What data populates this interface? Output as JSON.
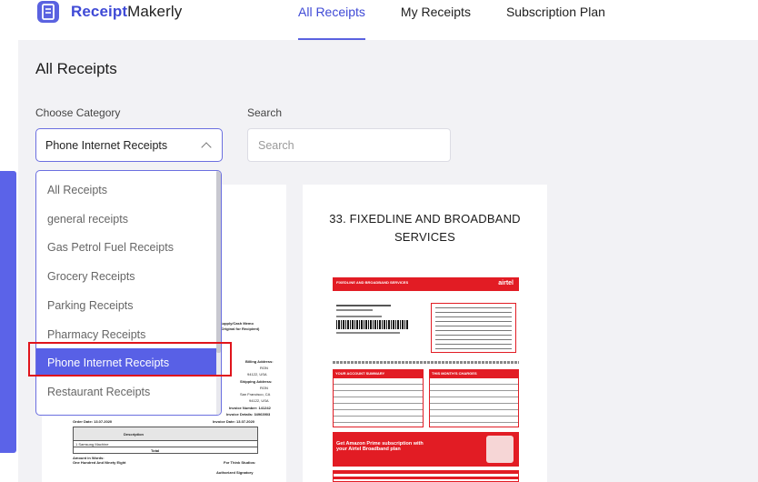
{
  "brand": {
    "name_bold": "Receipt",
    "name_light": "Makerly",
    "icon": "receipt-icon",
    "accent": "#3f4ad6"
  },
  "nav": [
    {
      "label": "All Receipts",
      "active": true
    },
    {
      "label": "My Receipts",
      "active": false
    },
    {
      "label": "Subscription Plan",
      "active": false
    }
  ],
  "page": {
    "title": "All Receipts"
  },
  "filters": {
    "category_label": "Choose Category",
    "category_value": "Phone Internet Receipts",
    "search_label": "Search",
    "search_placeholder": "Search",
    "search_value": ""
  },
  "dropdown": {
    "options": [
      "All Receipts",
      "general receipts",
      "Gas Petrol Fuel Receipts",
      "Grocery Receipts",
      "Parking Receipts",
      "Pharmacy Receipts",
      "Phone Internet Receipts",
      "Restaurant Receipts"
    ],
    "selected": "Phone Internet Receipts",
    "selected_color": "#5860e6"
  },
  "cards": {
    "left": {
      "preview": {
        "bill_header": "Supply/Cash Memo",
        "bill_sub": "(Original for Recipient)",
        "billing_address": "Billing Address:",
        "addr1": "RON",
        "addr2": "94122, USA",
        "shipping_address": "Shipping Address:",
        "addr3": "RON",
        "addr4": "San Francisco, CA",
        "addr5": "94122, USA",
        "invoice_number": "Invoice Number: 141242",
        "invoice_details": "Invoice Details: 34963903",
        "invoice_date": "Invoice Date: 13.07.2020",
        "order_date": "Order Date: 13.07.2020",
        "col_description": "Description",
        "item_name": "1 Samsung Machine",
        "total_label": "Total",
        "amount_words_label": "Amount in Words:",
        "amount_words": "One Hundred And Ninety Eight",
        "for_label": "For Think Studios:",
        "signatory": "Authorized Signatory"
      }
    },
    "right": {
      "title": "33. FIXEDLINE AND BROADBAND SERVICES",
      "preview": {
        "header": "FIXEDLINE AND BROADBAND SERVICES",
        "brand": "airtel",
        "summary": "YOUR ACCOUNT SUMMARY",
        "charges": "THIS MONTH'S CHARGES",
        "promo1": "Get Amazon Prime subscription with",
        "promo2": "your Airtel Broadband plan",
        "red": "#e21c24"
      }
    }
  }
}
